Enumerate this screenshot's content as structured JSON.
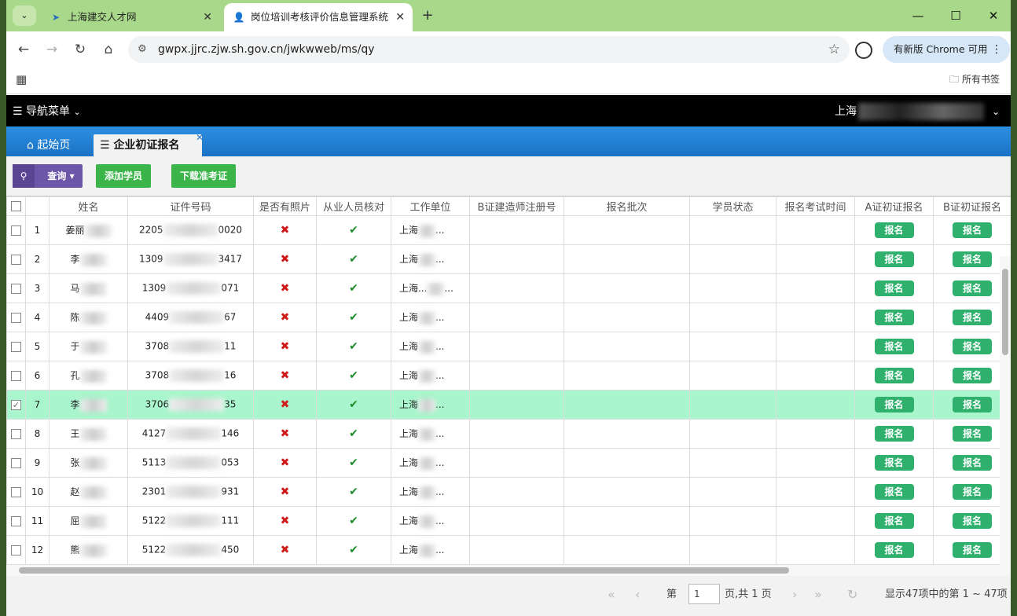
{
  "browser": {
    "tabs": [
      {
        "label": "上海建交人才网",
        "active": false
      },
      {
        "label": "岗位培训考核评价信息管理系统",
        "active": true
      }
    ],
    "url": "gwpx.jjrc.zjw.sh.gov.cn/jwkwweb/ms/qy",
    "update_label": "有新版 Chrome 可用",
    "all_bookmarks": "所有书签"
  },
  "app": {
    "menu_label": "导航菜单",
    "user_label": "上海",
    "tabs": {
      "home": "起始页",
      "current": "企业初证报名"
    },
    "toolbar": {
      "search": "查询",
      "add": "添加学员",
      "download": "下载准考证"
    },
    "columns": [
      "姓名",
      "证件号码",
      "是否有照片",
      "从业人员核对",
      "工作单位",
      "B证建造师注册号",
      "报名批次",
      "学员状态",
      "报名考试时间",
      "A证初证报名",
      "B证初证报名"
    ],
    "rows": [
      {
        "no": "1",
        "name": "姜丽",
        "id_prefix": "2205",
        "id_suffix": "0020",
        "unit": "上海",
        "selected": false
      },
      {
        "no": "2",
        "name": "李",
        "id_prefix": "1309",
        "id_suffix": "3417",
        "unit": "上海",
        "selected": false
      },
      {
        "no": "3",
        "name": "马",
        "id_prefix": "1309",
        "id_suffix": "071",
        "unit": "上海...",
        "selected": false
      },
      {
        "no": "4",
        "name": "陈",
        "id_prefix": "4409",
        "id_suffix": "67",
        "unit": "上海",
        "selected": false
      },
      {
        "no": "5",
        "name": "于",
        "id_prefix": "3708",
        "id_suffix": "11",
        "unit": "上海",
        "selected": false
      },
      {
        "no": "6",
        "name": "孔",
        "id_prefix": "3708",
        "id_suffix": "16",
        "unit": "上海",
        "selected": false
      },
      {
        "no": "7",
        "name": "李",
        "id_prefix": "3706",
        "id_suffix": "35",
        "unit": "上海",
        "selected": true
      },
      {
        "no": "8",
        "name": "王",
        "id_prefix": "4127",
        "id_suffix": "146",
        "unit": "上海",
        "selected": false
      },
      {
        "no": "9",
        "name": "张",
        "id_prefix": "5113",
        "id_suffix": "053",
        "unit": "上海",
        "selected": false
      },
      {
        "no": "10",
        "name": "赵",
        "id_prefix": "2301",
        "id_suffix": "931",
        "unit": "上海",
        "selected": false
      },
      {
        "no": "11",
        "name": "屈",
        "id_prefix": "5122",
        "id_suffix": "111",
        "unit": "上海",
        "selected": false
      },
      {
        "no": "12",
        "name": "熊",
        "id_prefix": "5122",
        "id_suffix": "450",
        "unit": "上海",
        "selected": false
      }
    ],
    "ellipsis": "...",
    "photo_mark": "✖",
    "check_mark": "✔",
    "enroll_label": "报名",
    "pager": {
      "page_prefix": "第",
      "page_value": "1",
      "page_suffix": "页,共 1 页",
      "summary": "显示47项中的第 1 ~ 47项"
    }
  },
  "colors": {
    "selected_row": "#a9f5cd",
    "header_bar": "#000000",
    "tab_bar": "#1a72c5",
    "enroll_button": "#2fb16d"
  }
}
